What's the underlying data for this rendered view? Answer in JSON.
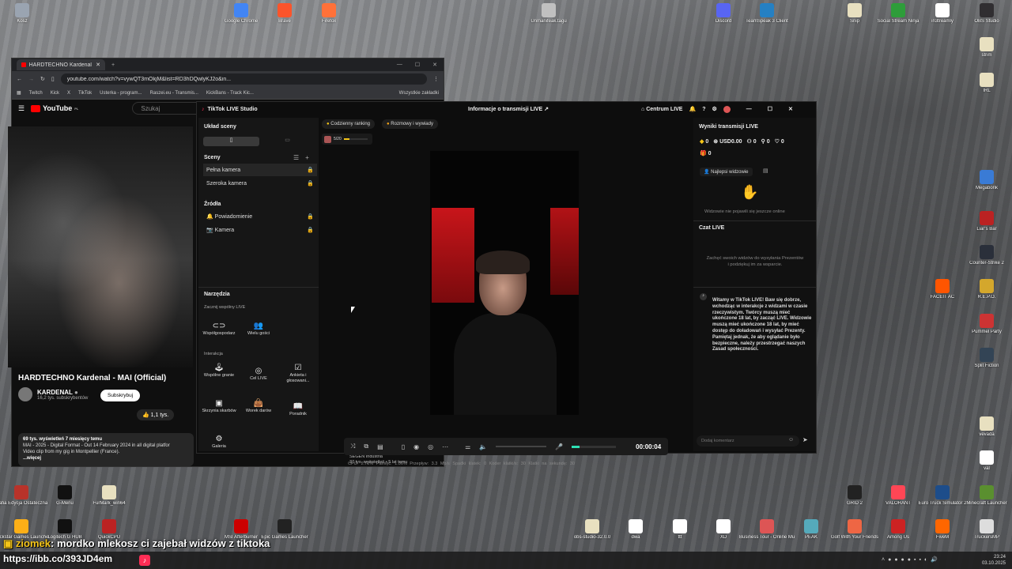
{
  "desktop": {
    "icons_top": [
      {
        "label": "Kosz",
        "color": "#9aa4b1"
      },
      {
        "label": "Google Chrome",
        "color": "#4285f4"
      },
      {
        "label": "Brave",
        "color": "#fb542b"
      },
      {
        "label": "Firefox",
        "color": "#ff7139"
      },
      {
        "label": "Unmanifeak.tagu",
        "color": "#c0c0c0"
      },
      {
        "label": "Discord",
        "color": "#5865f2"
      },
      {
        "label": "TeamSpeak 3 Client",
        "color": "#2580c3"
      },
      {
        "label": "Snip",
        "color": "#e8e0c0"
      },
      {
        "label": "Social Stream Ninja",
        "color": "#2e9d3a"
      },
      {
        "label": "in3treamly",
        "color": "#ffffff"
      },
      {
        "label": "OBS Studio",
        "color": "#302e31"
      }
    ],
    "icons_right": [
      {
        "label": "strim",
        "color": "#e8e0c0"
      },
      {
        "label": "IRL",
        "color": "#e8e0c0"
      },
      {
        "label": "Megabonk",
        "color": "#3a7bd5"
      },
      {
        "label": "Liar's Bar",
        "color": "#b22"
      },
      {
        "label": "Counter-Strike 2",
        "color": "#2a2f3a"
      },
      {
        "label": "FACEIT AC",
        "color": "#ff5500"
      },
      {
        "label": "R.E.P.O.",
        "color": "#d4a72c"
      },
      {
        "label": "Pummel Party",
        "color": "#c33"
      },
      {
        "label": "Split Fiction",
        "color": "#345"
      },
      {
        "label": "vevada",
        "color": "#e8e0c0"
      },
      {
        "label": "val",
        "color": "#ffffff"
      }
    ],
    "icons_bottom": [
      {
        "label": "Mafia Edycja Ostateczna",
        "color": "#b8332a"
      },
      {
        "label": "G-Menu",
        "color": "#111"
      },
      {
        "label": "FurMark_win64",
        "color": "#e8e0c0"
      },
      {
        "label": "GRID 2",
        "color": "#222"
      },
      {
        "label": "VALORANT",
        "color": "#ff4655"
      },
      {
        "label": "Euro Truck Simulator 2",
        "color": "#1d4d8a"
      },
      {
        "label": "Minecraft Launcher",
        "color": "#5a8f2f"
      },
      {
        "label": "Rockstar Games Launcher",
        "color": "#fcaf17"
      },
      {
        "label": "Logitech G HUB",
        "color": "#111"
      },
      {
        "label": "QuickCPU",
        "color": "#b22"
      },
      {
        "label": "MSI Afterburner",
        "color": "#c00"
      },
      {
        "label": "Epic Games Launcher",
        "color": "#222"
      },
      {
        "label": "obs-studio-32.0.0",
        "color": "#e8e0c0"
      },
      {
        "label": "dwa",
        "color": "#ffffff"
      },
      {
        "label": "ttt",
        "color": "#ffffff"
      },
      {
        "label": "XD",
        "color": "#ffffff"
      },
      {
        "label": "Business Tour - Online Multiplay...",
        "color": "#d55"
      },
      {
        "label": "PEAK",
        "color": "#5ab"
      },
      {
        "label": "Golf With Your Friends",
        "color": "#e64"
      },
      {
        "label": "Among Us",
        "color": "#c22"
      },
      {
        "label": "FiveM",
        "color": "#f60"
      },
      {
        "label": "TruckersMP",
        "color": "#ddd"
      }
    ]
  },
  "browser": {
    "tab_title": "HARDTECHNO Kardenal - MAI",
    "url": "youtube.com/watch?v=vywQT3mOkjM&list=RD3hDQwlyKJ2o&in...",
    "bookmarks": [
      "Twitch",
      "Kick",
      "X",
      "TikTok",
      "Usterka - program...",
      "Raszei.eu - Transmis...",
      "KickBans - Track Kic..."
    ],
    "bookmarks_all": "Wszystkie zakładki",
    "youtube_label": "YouTube",
    "youtube_sup": "PL",
    "search_placeholder": "Szukaj",
    "video_title": "HARDTECHNO Kardenal - MAI (Official)",
    "channel": "KARDENAL",
    "subscribers": "16,2 tys. subskrybentów",
    "subscribe": "Subskrybuj",
    "likes": "1,1 tys.",
    "views_line": "69 tys. wyświetleń  7 miesięcy temu",
    "desc1": "MAI - 2025 - Digital Format - Out 14 February 2024 in all digital platfor",
    "desc2": "Video clip from my gig in Montpellier (France).",
    "more": "...więcej",
    "side_title": "SEGEN Industria",
    "side_meta": "37 tys. wyświetleń • 5 lat temu"
  },
  "tiktok": {
    "app_title": "TikTok LIVE Studio",
    "center_title": "Informacje o transmisji LIVE",
    "center_hub": "Centrum LIVE",
    "layout_label": "Układ sceny",
    "scenes_label": "Sceny",
    "scenes": [
      "Pełna kamera",
      "Szeroka kamera"
    ],
    "sources_label": "Źródła",
    "sources": [
      "Powiadomienie",
      "Kamera"
    ],
    "tools_label": "Narzędzia",
    "start_shared": "Zacznij wspólny LIVE",
    "shared_tools": [
      "Współgospodarz",
      "Wielu gości"
    ],
    "interaction_label": "Interakcja",
    "interaction_tools": [
      "Wspólne granie",
      "Cel LIVE",
      "Ankieta i głosowani...",
      "Skrzynia skarbów",
      "Worek darów",
      "Poradnik",
      "Galeria"
    ],
    "chip_ranking": "Codzienny ranking",
    "chip_talk": "Rozmowy i wywiady",
    "goal_text": "5/20",
    "timer": "00:00:04",
    "stats": "CPU: 2.72%  Pamięć: 1.06%  Przepływ: 3.3 Mb/s  Spadki klatek: 0  Koder klatki/s: 30  Klatki na sekundę: 30",
    "results_label": "Wyniki transmisji LIVE",
    "result_values": [
      "0",
      "USD0.00",
      "0",
      "0",
      "0",
      "0"
    ],
    "top_viewers": "Najlepsi widzowie",
    "no_viewers": "Widzowie nie pojawili się jeszcze online",
    "chat_label": "Czat LIVE",
    "chat_prompt": "Zachęć swoich widzów do wysyłania Prezentów i podziękuj im za wsparcie.",
    "welcome": "Witamy w TikTok LIVE! Baw się dobrze, wchodząc w interakcje z widzami w czasie rzeczywistym. Twórcy muszą mieć ukończone 18 lat, by zacząć LIVE. Widzowie muszą mieć ukończone 18 lat, by mieć dostęp do doładowań i wysyłać Prezenty. Pamiętaj jednak, że aby oglądanie było bezpieczne, należy przestrzegać naszych Zasad społeczności.",
    "comment_placeholder": "Dodaj komentarz"
  },
  "overlay": {
    "chat_user": "ziomek",
    "chat_msg": ": mordko mlekosz ci zajebał widzów z tiktoka",
    "link": "https://ibb.co/393JD4em",
    "time": "23:24",
    "date": "03.10.2025"
  }
}
